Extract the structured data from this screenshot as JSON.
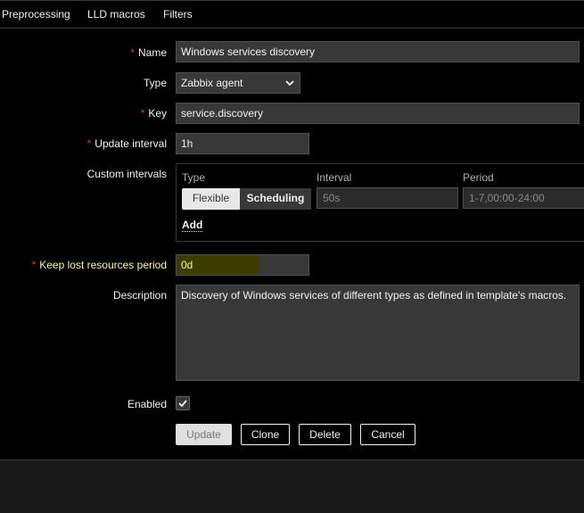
{
  "tabs": [
    "Preprocessing",
    "LLD macros",
    "Filters"
  ],
  "form": {
    "name": {
      "label": "Name",
      "value": "Windows services discovery"
    },
    "type": {
      "label": "Type",
      "value": "Zabbix agent"
    },
    "key": {
      "label": "Key",
      "value": "service.discovery"
    },
    "update_interval": {
      "label": "Update interval",
      "value": "1h"
    },
    "custom_intervals": {
      "label": "Custom intervals",
      "headers": [
        "Type",
        "Interval",
        "Period"
      ],
      "type_options": [
        "Flexible",
        "Scheduling"
      ],
      "interval_placeholder": "50s",
      "period_placeholder": "1-7,00:00-24:00",
      "add_label": "Add"
    },
    "keep_lost": {
      "label": "Keep lost resources period",
      "value": "0d"
    },
    "description": {
      "label": "Description",
      "value": "Discovery of Windows services of different types as defined in template's macros."
    },
    "enabled": {
      "label": "Enabled",
      "checked": true
    }
  },
  "buttons": {
    "update": "Update",
    "clone": "Clone",
    "delete": "Delete",
    "cancel": "Cancel"
  },
  "required_mark": "*"
}
